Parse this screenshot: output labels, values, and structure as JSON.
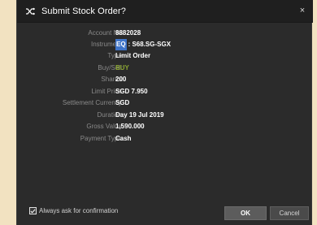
{
  "window": {
    "title": "Submit Stock Order?",
    "close_symbol": "×"
  },
  "details": [
    {
      "label": "Account No:",
      "value": "8882028"
    },
    {
      "label": "Instrument:",
      "value_prefix": "EQ",
      "value": ": S68.SG-SGX"
    },
    {
      "label": "Type:",
      "value": "Limit Order"
    },
    {
      "label": "Buy/Sell:",
      "value": "BUY"
    },
    {
      "label": "Shares:",
      "value": "200"
    },
    {
      "label": "Limit Price:",
      "value": "SGD 7.950"
    },
    {
      "label": "Settlement Currency:",
      "value": "SGD"
    },
    {
      "label": "Duration:",
      "value": "Day 19 Jul 2019"
    },
    {
      "label": "Gross Value:",
      "value": "1,590.000"
    },
    {
      "label": "Payment Type:",
      "value": "Cash"
    }
  ],
  "footer": {
    "checkbox_label": "Always ask for confirmation",
    "checkbox_checked": true,
    "ok_label": "OK",
    "cancel_label": "Cancel"
  },
  "colors": {
    "dialog_bg": "#2b2b2b",
    "title_bg": "#1f1f1f",
    "label": "#8a8a8a",
    "buy": "#8aa531",
    "highlight": "#3f74c9"
  },
  "icons": {
    "title_icon": "shuffle-icon",
    "close_icon": "close-icon",
    "checkbox_icon": "checkmark-icon"
  }
}
